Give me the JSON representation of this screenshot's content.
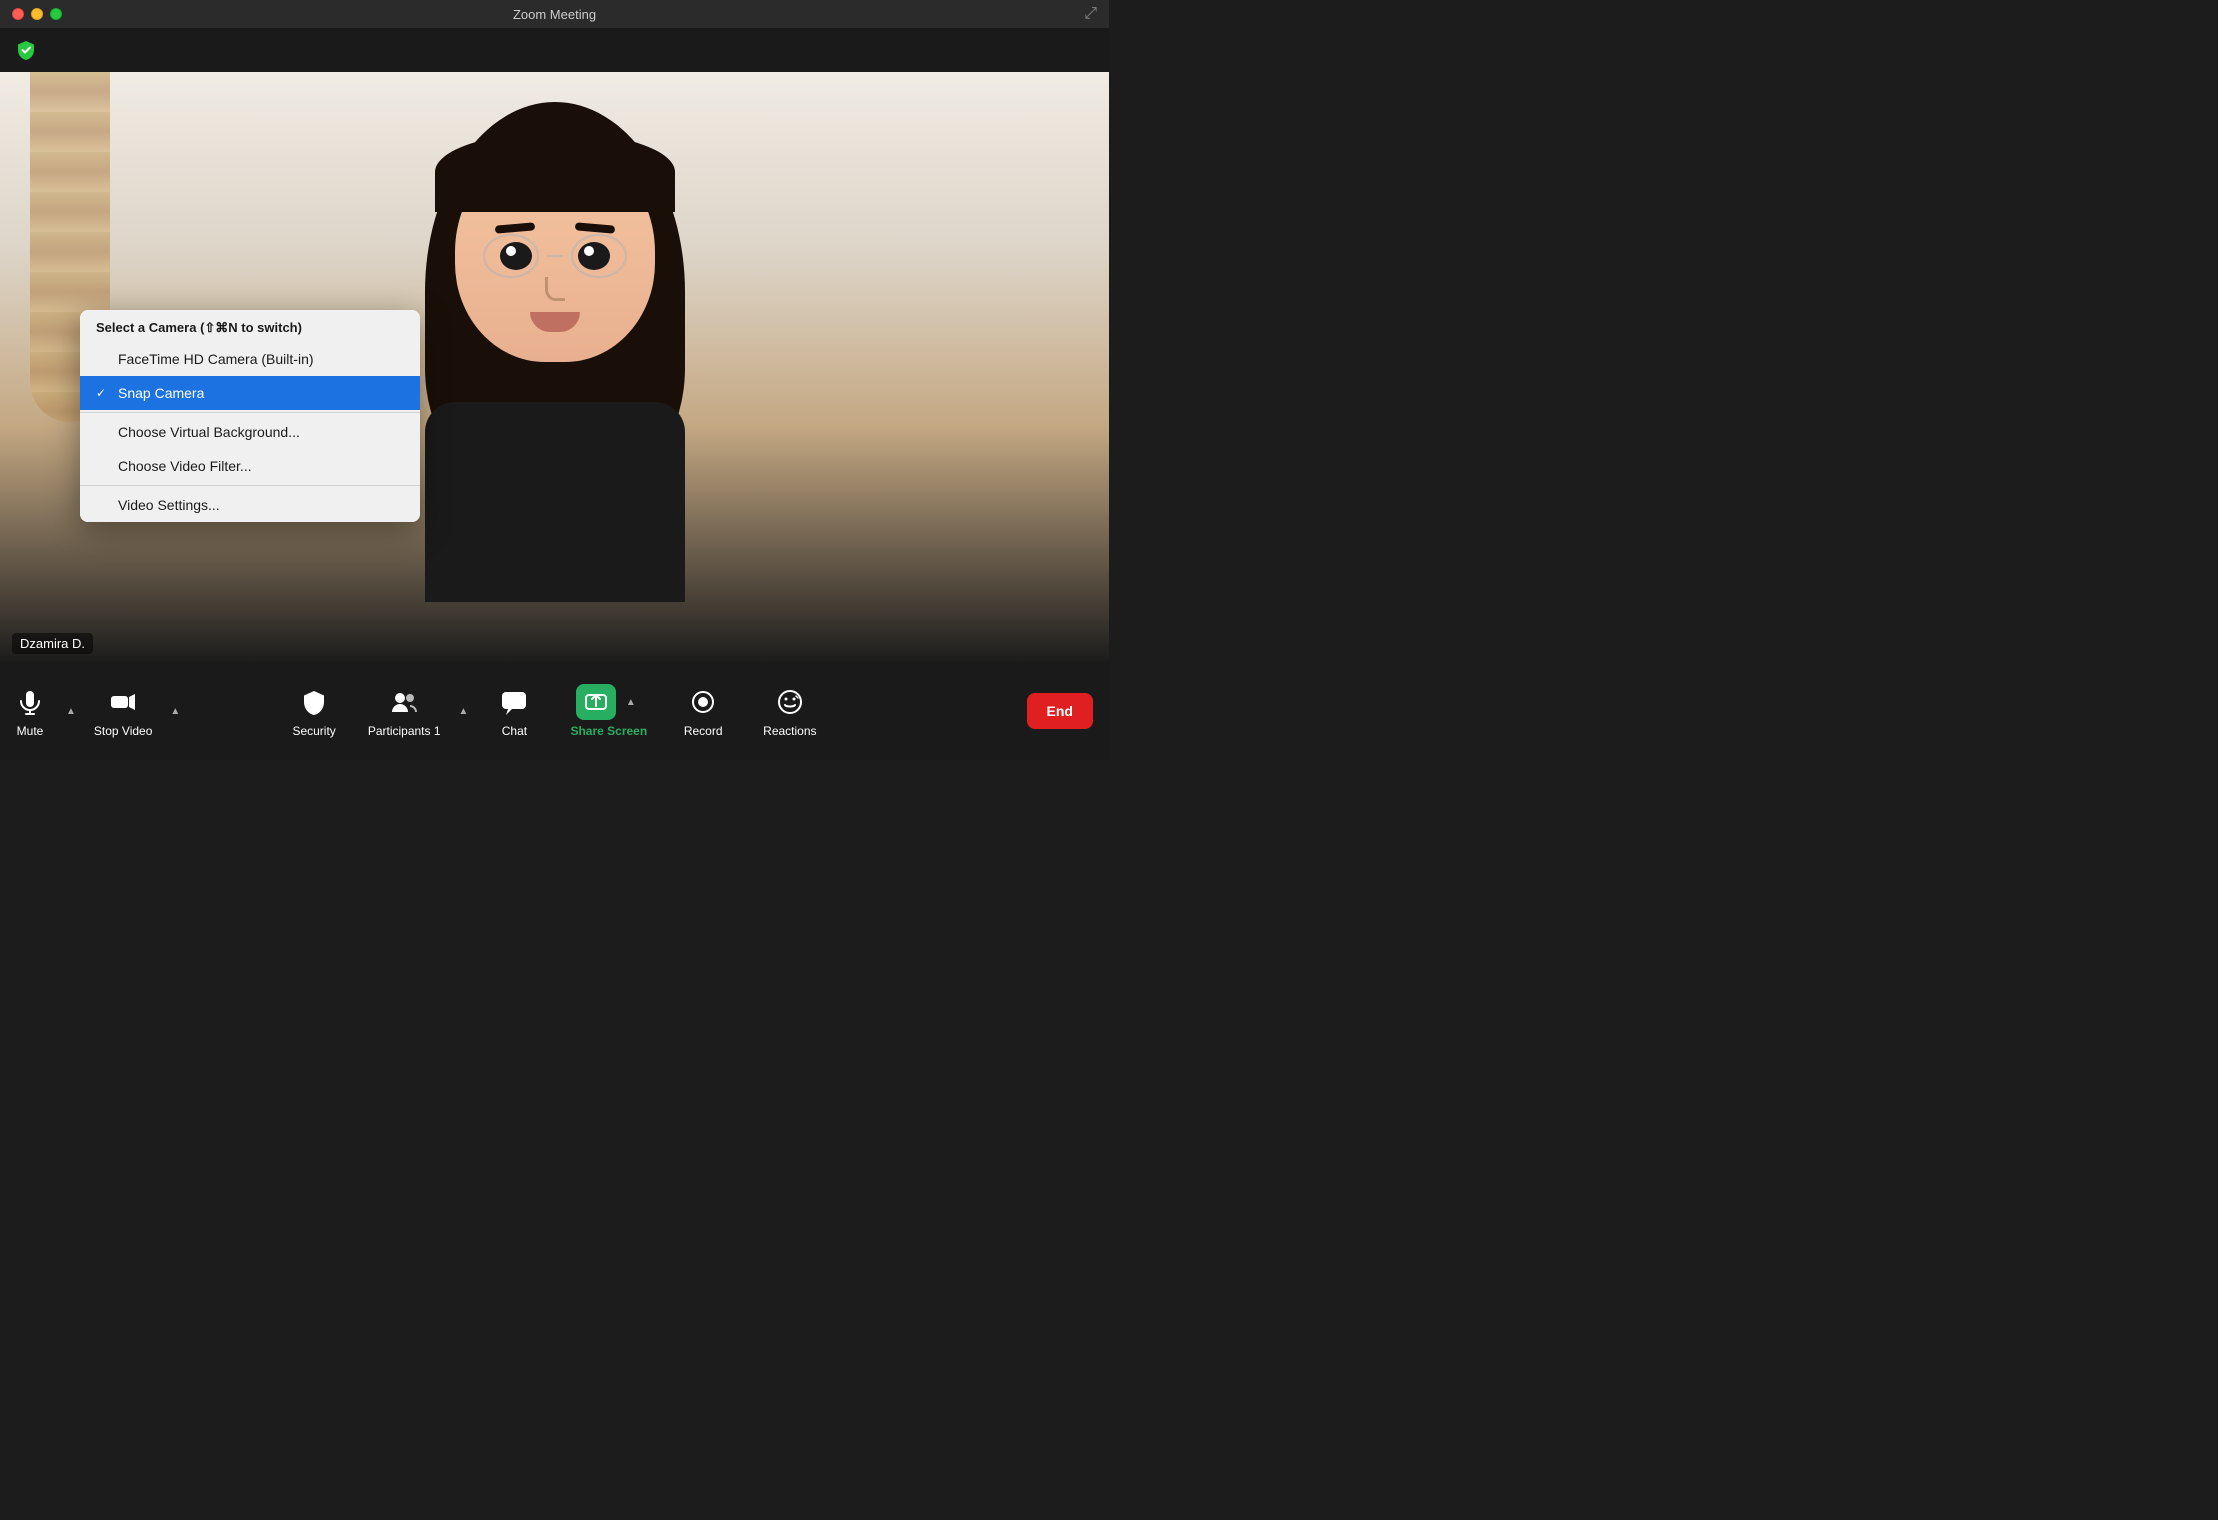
{
  "window": {
    "title": "Zoom Meeting"
  },
  "topbar": {
    "shield_title": "Zoom security shield"
  },
  "video": {
    "participant_name": "Dzamira D."
  },
  "camera_menu": {
    "header": "Select a Camera (⇧⌘N to switch)",
    "items": [
      {
        "id": "facetime",
        "label": "FaceTime HD Camera (Built-in)",
        "selected": false
      },
      {
        "id": "snap",
        "label": "Snap Camera",
        "selected": true
      },
      {
        "id": "virtual-bg",
        "label": "Choose Virtual Background...",
        "selected": false
      },
      {
        "id": "video-filter",
        "label": "Choose Video Filter...",
        "selected": false
      },
      {
        "id": "settings",
        "label": "Video Settings...",
        "selected": false
      }
    ]
  },
  "toolbar": {
    "mute_label": "Mute",
    "stop_video_label": "Stop Video",
    "security_label": "Security",
    "participants_label": "Participants",
    "participants_count": "1",
    "chat_label": "Chat",
    "share_screen_label": "Share Screen",
    "record_label": "Record",
    "reactions_label": "Reactions",
    "end_label": "End"
  },
  "colors": {
    "accent_green": "#27ae60",
    "accent_red": "#e02020",
    "toolbar_bg": "#1a1a1a",
    "menu_selected": "#1c72e0"
  }
}
